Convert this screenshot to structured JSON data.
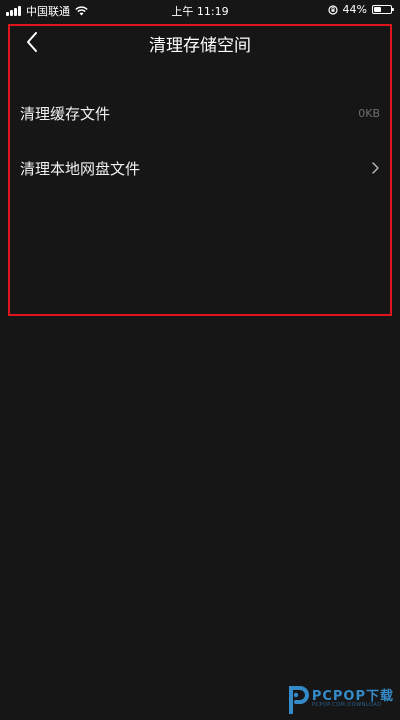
{
  "status_bar": {
    "carrier": "中国联通",
    "time": "上午 11:19",
    "battery": "44%",
    "battery_level": 0.44,
    "icons": [
      "signal-icon",
      "wifi-icon",
      "orientation-lock-icon",
      "battery-icon"
    ]
  },
  "header": {
    "title": "清理存储空间",
    "back_icon": "chevron-left-icon"
  },
  "rows": [
    {
      "label": "清理缓存文件",
      "value": "0KB"
    },
    {
      "label": "清理本地网盘文件",
      "icon": "chevron-right-icon"
    }
  ],
  "watermark": {
    "text": "PCPOP下载",
    "sub": "PCPOP.COM.DOWNLOAD"
  },
  "colors": {
    "background": "#161616",
    "highlight_border": "#e0161f",
    "watermark": "#3aa0e8",
    "secondary_text": "#6e6e6e"
  }
}
